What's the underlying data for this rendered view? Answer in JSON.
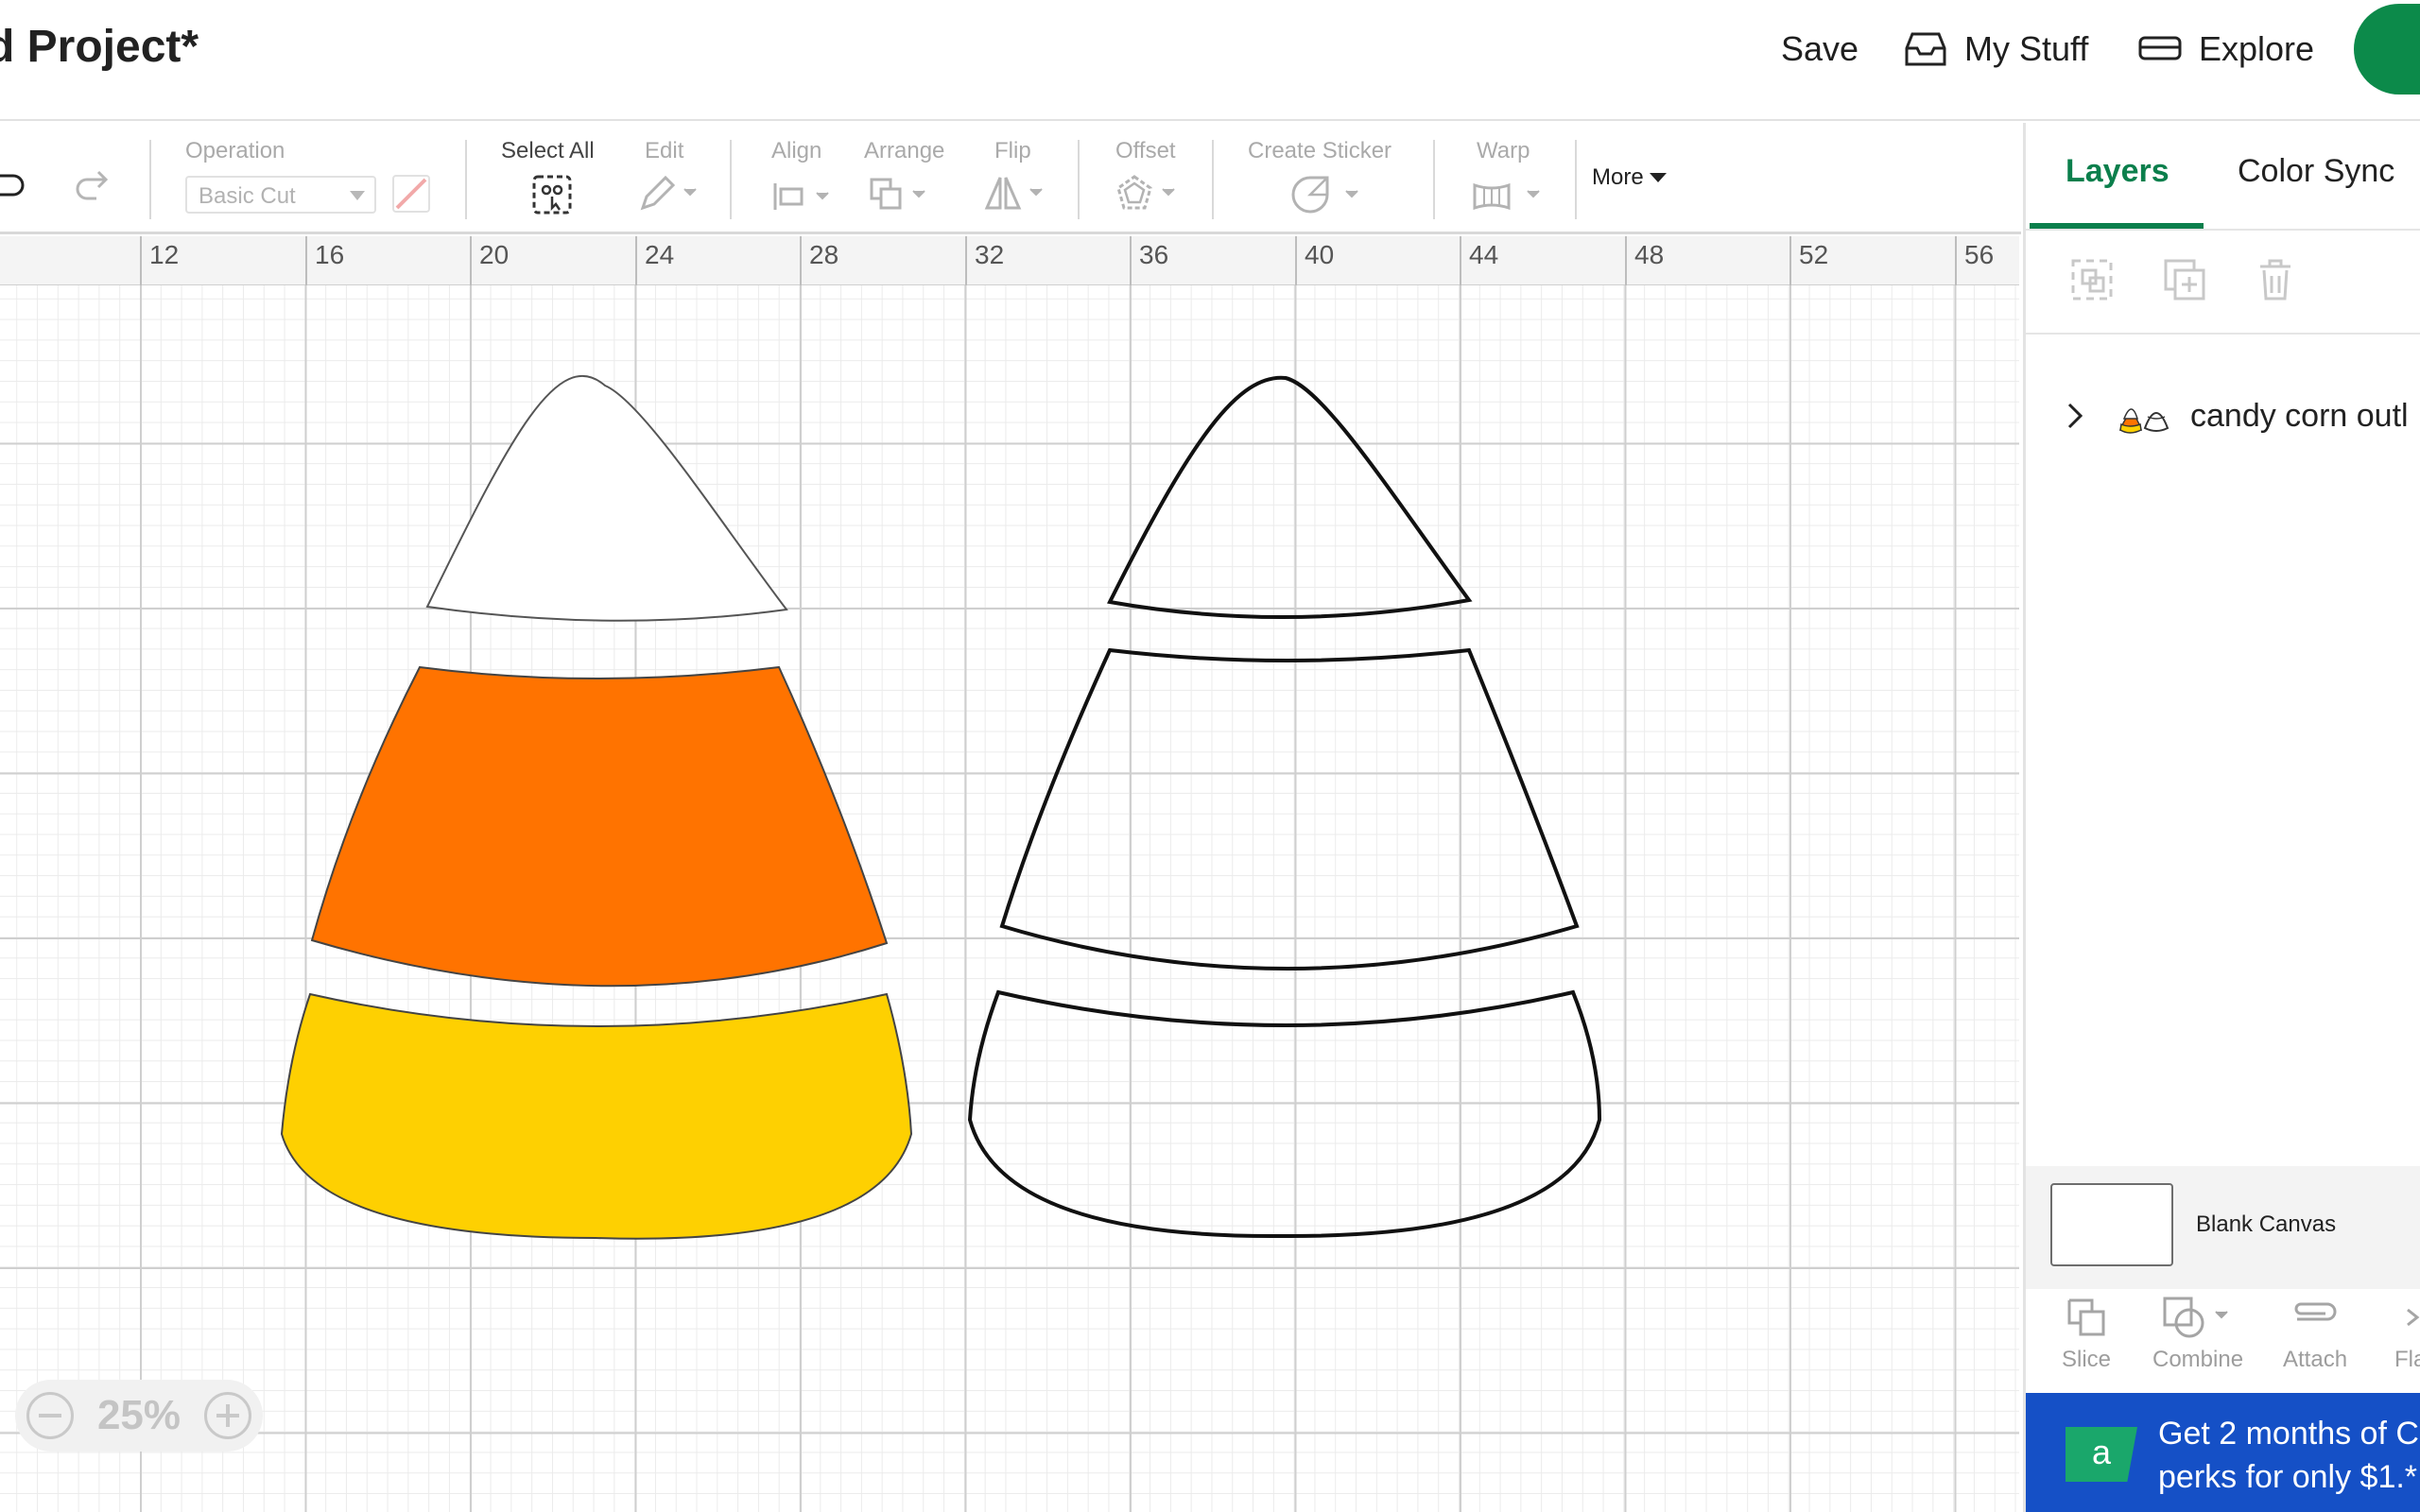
{
  "header": {
    "project_title": "d Project*",
    "save_label": "Save",
    "my_stuff_label": "My Stuff",
    "explore_label": "Explore"
  },
  "toolbar": {
    "operation_label": "Operation",
    "operation_value": "Basic Cut",
    "select_all_label": "Select All",
    "edit_label": "Edit",
    "align_label": "Align",
    "arrange_label": "Arrange",
    "flip_label": "Flip",
    "offset_label": "Offset",
    "create_sticker_label": "Create Sticker",
    "warp_label": "Warp",
    "more_label": "More"
  },
  "ruler": {
    "ticks": [
      "12",
      "16",
      "20",
      "24",
      "28",
      "32",
      "36",
      "40",
      "44",
      "48",
      "52",
      "56"
    ]
  },
  "canvas": {
    "zoom": "25%",
    "colors": {
      "white_piece": "#ffffff",
      "orange_piece": "#ff7300",
      "yellow_piece": "#fed001",
      "outline": "#111111"
    }
  },
  "panel": {
    "tab_layers": "Layers",
    "tab_color_sync": "Color Sync",
    "layer_name": "candy corn outl",
    "blank_canvas_label": "Blank Canvas",
    "tools": {
      "slice": "Slice",
      "combine": "Combine",
      "attach": "Attach",
      "flatten": "Fla"
    }
  },
  "ad": {
    "logo": "a",
    "line1": "Get 2 months of C",
    "line2": "perks for only $1.*"
  }
}
